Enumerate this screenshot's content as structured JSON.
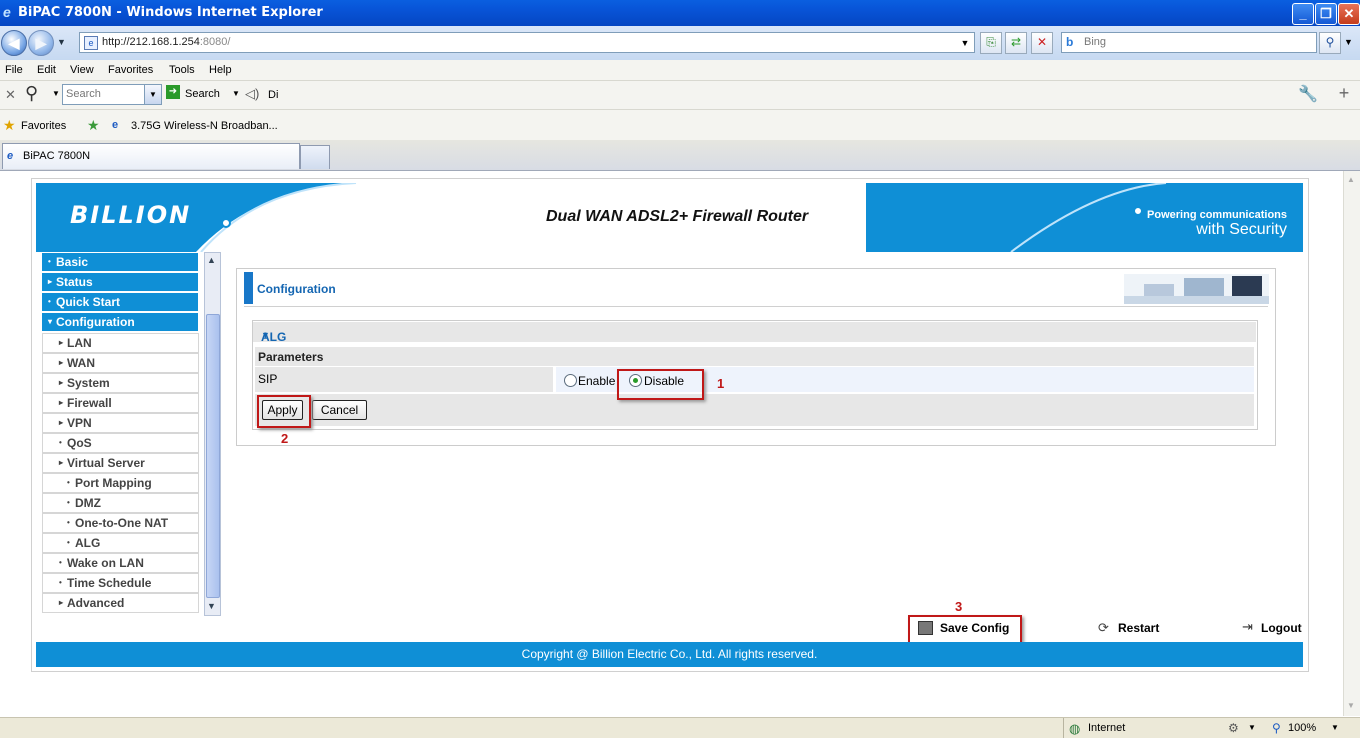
{
  "window": {
    "title": "BiPAC 7800N - Windows Internet Explorer"
  },
  "address_bar": {
    "url_host": "http://212.168.1.254",
    "url_port": ":8080/",
    "search_placeholder": "Bing"
  },
  "menu": [
    "File",
    "Edit",
    "View",
    "Favorites",
    "Tools",
    "Help"
  ],
  "toolbar": {
    "search_placeholder": "Search",
    "search_label": "Search",
    "extra": "Di"
  },
  "favorites": {
    "label": "Favorites",
    "link": "3.75G Wireless-N Broadban..."
  },
  "tab": {
    "title": "BiPAC 7800N"
  },
  "router": {
    "logo": "BILLION",
    "title": "Dual WAN ADSL2+ Firewall Router",
    "tagline_top": "Powering communications",
    "tagline_bottom": "with Security",
    "nav": [
      {
        "label": "Basic",
        "level": "top",
        "mark": "•"
      },
      {
        "label": "Status",
        "level": "top",
        "mark": "▸"
      },
      {
        "label": "Quick Start",
        "level": "top",
        "mark": "•"
      },
      {
        "label": "Configuration",
        "level": "top",
        "mark": "▾"
      },
      {
        "label": "LAN",
        "level": "sub",
        "mark": "▸"
      },
      {
        "label": "WAN",
        "level": "sub",
        "mark": "▸"
      },
      {
        "label": "System",
        "level": "sub",
        "mark": "▸"
      },
      {
        "label": "Firewall",
        "level": "sub",
        "mark": "▸"
      },
      {
        "label": "VPN",
        "level": "sub",
        "mark": "▸"
      },
      {
        "label": "QoS",
        "level": "sub",
        "mark": "•"
      },
      {
        "label": "Virtual Server",
        "level": "sub",
        "mark": "▸"
      },
      {
        "label": "Port Mapping",
        "level": "sub2",
        "mark": "•"
      },
      {
        "label": "DMZ",
        "level": "sub2",
        "mark": "•"
      },
      {
        "label": "One-to-One NAT",
        "level": "sub2",
        "mark": "•"
      },
      {
        "label": "ALG",
        "level": "sub2",
        "mark": "•"
      },
      {
        "label": "Wake on LAN",
        "level": "sub",
        "mark": "•"
      },
      {
        "label": "Time Schedule",
        "level": "sub",
        "mark": "•"
      },
      {
        "label": "Advanced",
        "level": "sub",
        "mark": "▸"
      }
    ],
    "panel_title": "Configuration",
    "section_title": "ALG",
    "params_label": "Parameters",
    "sip_label": "SIP",
    "enable_label": "Enable",
    "disable_label": "Disable",
    "sip_selected": "Disable",
    "apply_label": "Apply",
    "cancel_label": "Cancel",
    "annotations": [
      "1",
      "2",
      "3"
    ],
    "save_config": "Save Config",
    "restart": "Restart",
    "logout": "Logout",
    "copyright": "Copyright @ Billion Electric Co., Ltd. All rights reserved."
  },
  "statusbar": {
    "zone": "Internet",
    "zoom": "100%"
  }
}
